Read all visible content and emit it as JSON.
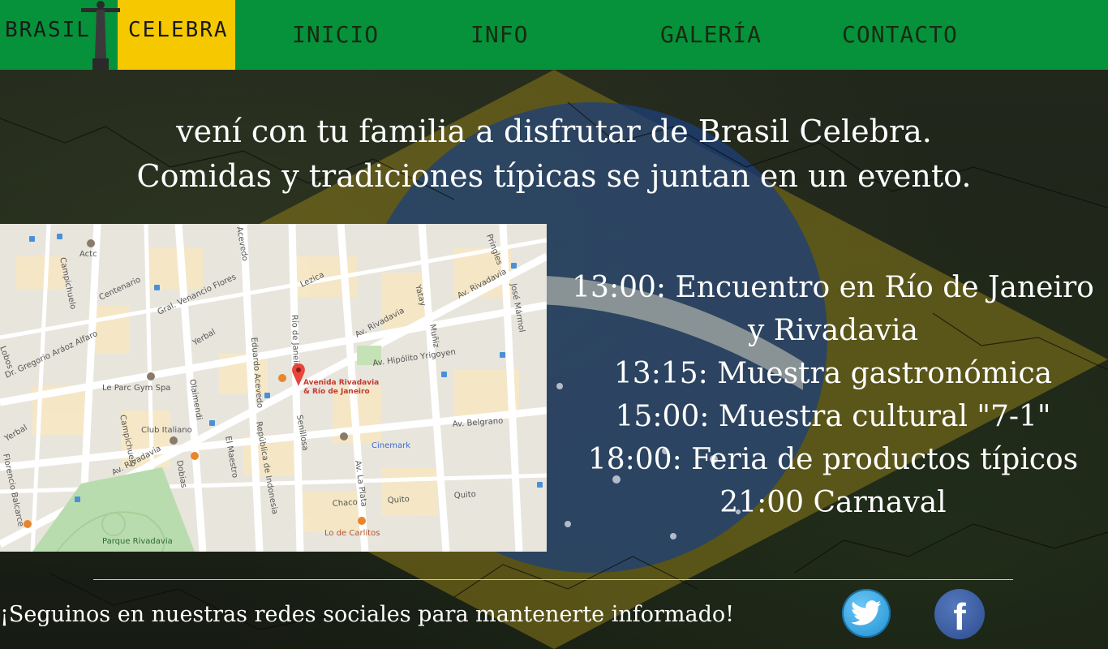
{
  "logo": {
    "word1": "BRASIL",
    "word2": "CELEBRA"
  },
  "nav": [
    {
      "label": "INICIO"
    },
    {
      "label": "INFO"
    },
    {
      "label": "GALERÍA"
    },
    {
      "label": "CONTACTO"
    }
  ],
  "intro": {
    "line1": "vení con tu familia a disfrutar de Brasil Celebra.",
    "line2": "Comidas y tradiciones típicas se juntan en un evento."
  },
  "map": {
    "marker_label_line1": "Avenida Rivadavia",
    "marker_label_line2": "& Río de Janeiro",
    "streets": [
      "Av. Rivadavia",
      "Av. Rivadavia",
      "Av. Rivadavia",
      "Av. Hipólito Yrigoyen",
      "Av. Belgrano",
      "Av. La Plata",
      "Yerbal",
      "Yerbal",
      "Centenario",
      "Gral. Venancio Flores",
      "Lezica",
      "Río de Janeiro",
      "Eduardo Acevedo",
      "Olaimendi",
      "Campichuelo",
      "Campichuelo",
      "Muñiz",
      "Yatay",
      "Pringles",
      "José Mármol",
      "Senillosa",
      "Dobias",
      "El Maestro",
      "República de Indonesia",
      "Quito",
      "Quito",
      "Chaco",
      "Acevedo",
      "Florencio Balcarce",
      "Dr. Gregorio Aráoz Alfaro",
      "Lobos"
    ],
    "places": [
      "Actc",
      "Le Parc Gym Spa",
      "Club Italiano",
      "Cinemark",
      "Lo de Carlitos",
      "Parque Rivadavia"
    ]
  },
  "schedule": [
    {
      "time": "13:00:",
      "text": "Encuentro en Río de Janeiro"
    },
    {
      "time": "",
      "text": "y Rivadavia"
    },
    {
      "time": "13:15:",
      "text": "Muestra gastronómica"
    },
    {
      "time": "15:00:",
      "text": "Muestra cultural \"7-1\""
    },
    {
      "time": "18:00:",
      "text": "Feria de productos típicos"
    },
    {
      "time": "21:00",
      "text": "Carnaval"
    }
  ],
  "footer": {
    "social_text": "¡Seguinos en nuestras redes sociales para mantenerte informado!"
  },
  "colors": {
    "green": "#05923b",
    "yellow": "#f6c800",
    "blue": "#1e3d7a",
    "twitter": "#1d8fd3",
    "facebook": "#2d4c8f"
  },
  "icons": {
    "twitter": "twitter-icon",
    "facebook": "facebook-icon"
  }
}
